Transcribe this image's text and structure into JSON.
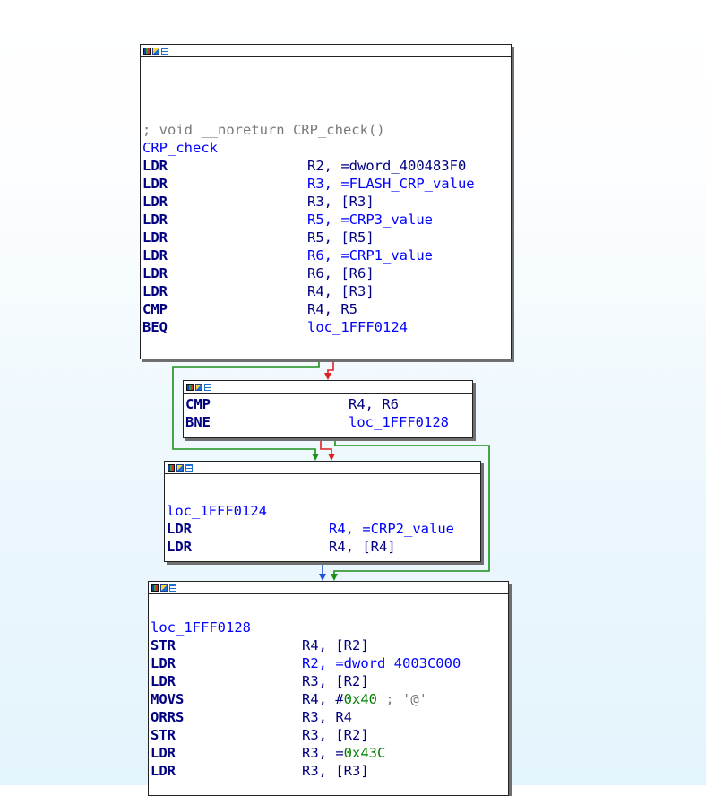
{
  "colors": {
    "mnemonic": "#000080",
    "label": "#0000ff",
    "comment": "#7a7a7a",
    "immediate": "#008000",
    "edge_true": "#1a8f1a",
    "edge_false": "#e02020",
    "edge_jump": "#1f4fd6"
  },
  "icons": [
    "graph-icon",
    "edit-icon",
    "grid-icon"
  ],
  "blocks": {
    "b1": {
      "header_comment": "; void __noreturn CRP_check()",
      "label": "CRP_check",
      "instructions": [
        {
          "mnemonic": "LDR",
          "operands": "R2, =dword_400483F0"
        },
        {
          "mnemonic": "LDR",
          "operands": "R3, =FLASH_CRP_value"
        },
        {
          "mnemonic": "LDR",
          "operands": "R3, [R3]"
        },
        {
          "mnemonic": "LDR",
          "operands": "R5, =CRP3_value"
        },
        {
          "mnemonic": "LDR",
          "operands": "R5, [R5]"
        },
        {
          "mnemonic": "LDR",
          "operands": "R6, =CRP1_value"
        },
        {
          "mnemonic": "LDR",
          "operands": "R6, [R6]"
        },
        {
          "mnemonic": "LDR",
          "operands": "R4, [R3]"
        },
        {
          "mnemonic": "CMP",
          "operands": "R4, R5"
        },
        {
          "mnemonic": "BEQ",
          "operands": "loc_1FFF0124"
        }
      ]
    },
    "b2": {
      "instructions": [
        {
          "mnemonic": "CMP",
          "operands": "R4, R6"
        },
        {
          "mnemonic": "BNE",
          "operands": "loc_1FFF0128"
        }
      ]
    },
    "b3": {
      "label": "loc_1FFF0124",
      "instructions": [
        {
          "mnemonic": "LDR",
          "operands": "R4, =CRP2_value"
        },
        {
          "mnemonic": "LDR",
          "operands": "R4, [R4]"
        }
      ]
    },
    "b4": {
      "label": "loc_1FFF0128",
      "instructions": [
        {
          "mnemonic": "STR",
          "operands": "R4, [R2]"
        },
        {
          "mnemonic": "LDR",
          "operands": "R2, =dword_4003C000"
        },
        {
          "mnemonic": "LDR",
          "operands": "R3, [R2]"
        },
        {
          "mnemonic": "MOVS",
          "operands_prefix": "R4, #",
          "operands_imm": "0x40",
          "operands_comment": " ; '@'"
        },
        {
          "mnemonic": "ORRS",
          "operands": "R3, R4"
        },
        {
          "mnemonic": "STR",
          "operands": "R3, [R2]"
        },
        {
          "mnemonic": "LDR",
          "operands_prefix": "R3, =",
          "operands_imm": "0x43C"
        },
        {
          "mnemonic": "LDR",
          "operands": "R3, [R3]"
        }
      ]
    }
  }
}
